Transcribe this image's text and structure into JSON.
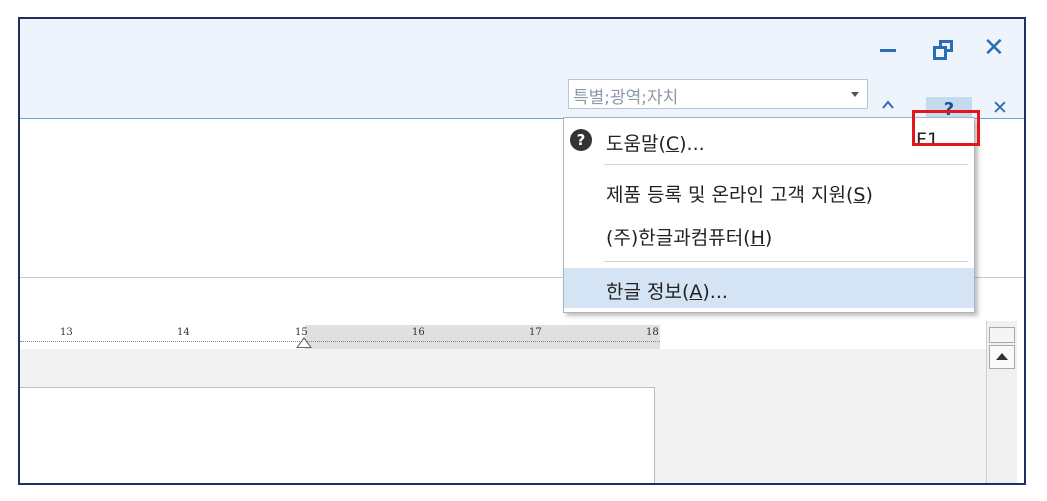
{
  "window": {
    "minimize_icon": "minimize-icon",
    "restore_icon": "restore-icon",
    "close_glyph": "✕"
  },
  "toolbar": {
    "style_combo_value": "특별;광역;자치",
    "help_glyph": "?",
    "ribbon_close_glyph": "✕"
  },
  "ruler": {
    "numbers": [
      "13",
      "14",
      "15",
      "16",
      "17",
      "18"
    ]
  },
  "help_menu": {
    "items": [
      {
        "icon": "help-circle-icon",
        "label_pre": "도움말(",
        "mnemonic": "C",
        "label_post": ")...",
        "shortcut": "F1"
      },
      {
        "label_pre": "제품 등록 및 온라인 고객 지원(",
        "mnemonic": "S",
        "label_post": ")"
      },
      {
        "label_pre": "(주)한글과컴퓨터(",
        "mnemonic": "H",
        "label_post": ")"
      },
      {
        "label_pre": "한글 정보(",
        "mnemonic": "A",
        "label_post": ")..."
      }
    ]
  },
  "colors": {
    "accent": "#2d6db8",
    "highlight_box": "#e3161c",
    "menu_hover": "#d5e4f4"
  }
}
